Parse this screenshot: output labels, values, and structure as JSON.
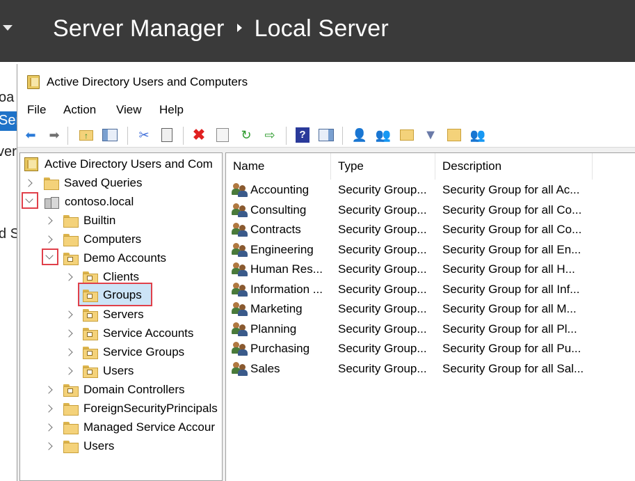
{
  "server_manager": {
    "breadcrumb_root": "Server Manager",
    "breadcrumb_current": "Local Server",
    "left_fragments": [
      "oa",
      "Ser",
      "ver",
      "d S"
    ]
  },
  "window": {
    "title": "Active Directory Users and Computers",
    "menu": [
      "File",
      "Action",
      "View",
      "Help"
    ]
  },
  "toolbar_icons": [
    "back-icon",
    "forward-icon",
    "up-folder-icon",
    "show-hide-console-tree-icon",
    "cut-icon",
    "copy-icon",
    "delete-icon",
    "properties-icon",
    "refresh-icon",
    "export-list-icon",
    "help-icon",
    "action-pane-icon",
    "new-user-icon",
    "new-group-icon",
    "new-ou-icon",
    "filter-icon",
    "find-icon",
    "add-to-group-icon"
  ],
  "tree": {
    "root": "Active Directory Users and Com",
    "items": [
      {
        "label": "Saved Queries"
      },
      {
        "label": "contoso.local"
      },
      {
        "label": "Builtin"
      },
      {
        "label": "Computers"
      },
      {
        "label": "Demo Accounts"
      },
      {
        "label": "Clients"
      },
      {
        "label": "Groups"
      },
      {
        "label": "Servers"
      },
      {
        "label": "Service Accounts"
      },
      {
        "label": "Service Groups"
      },
      {
        "label": "Users"
      },
      {
        "label": "Domain Controllers"
      },
      {
        "label": "ForeignSecurityPrincipals"
      },
      {
        "label": "Managed Service Accour"
      },
      {
        "label": "Users"
      }
    ]
  },
  "list": {
    "columns": [
      "Name",
      "Type",
      "Description"
    ],
    "rows": [
      {
        "name": "Accounting",
        "type": "Security Group...",
        "description": "Security Group for all Ac..."
      },
      {
        "name": "Consulting",
        "type": "Security Group...",
        "description": "Security Group for all Co..."
      },
      {
        "name": "Contracts",
        "type": "Security Group...",
        "description": "Security Group for all Co..."
      },
      {
        "name": "Engineering",
        "type": "Security Group...",
        "description": "Security Group for all En..."
      },
      {
        "name": "Human Res...",
        "type": "Security Group...",
        "description": "Security Group for all H..."
      },
      {
        "name": "Information ...",
        "type": "Security Group...",
        "description": "Security Group for all Inf..."
      },
      {
        "name": "Marketing",
        "type": "Security Group...",
        "description": "Security Group for all M..."
      },
      {
        "name": "Planning",
        "type": "Security Group...",
        "description": "Security Group for all Pl..."
      },
      {
        "name": "Purchasing",
        "type": "Security Group...",
        "description": "Security Group for all Pu..."
      },
      {
        "name": "Sales",
        "type": "Security Group...",
        "description": "Security Group for all Sal..."
      }
    ]
  },
  "colors": {
    "sm_header": "#3a3a3a",
    "sm_selection": "#1e72c8",
    "highlight_box": "#e0404a",
    "tree_selection": "#cce4f7"
  }
}
